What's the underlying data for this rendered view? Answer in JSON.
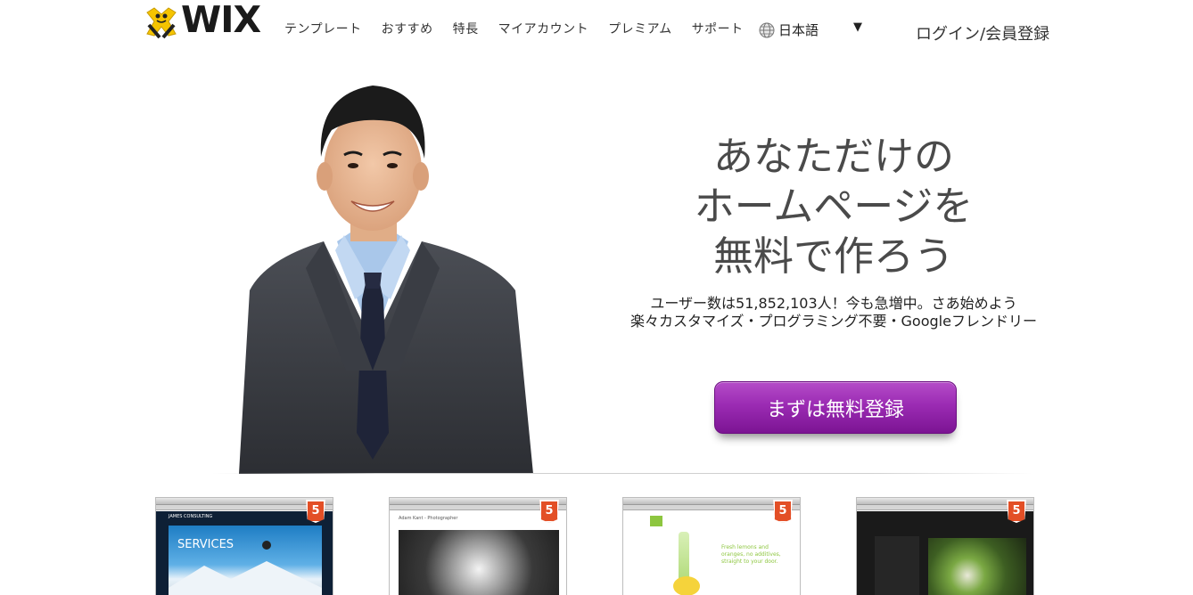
{
  "header": {
    "logo": "WIX",
    "nav": [
      "テンプレート",
      "おすすめ",
      "特長",
      "マイアカウント",
      "プレミアム",
      "サポート"
    ],
    "language": "日本語",
    "login": "ログイン/会員登録"
  },
  "hero": {
    "title_lines": [
      "あなただけの",
      "ホームページを",
      "無料で作ろう"
    ],
    "subtitle_lines": [
      "ユーザー数は51,852,103人！今も急増中。さあ始めよう",
      "楽々カスタマイズ・プログラミング不要・Googleフレンドリー"
    ],
    "cta": "まずは無料登録"
  },
  "templates": [
    {
      "badge": "5",
      "name": "JAMES CONSULTING",
      "heading": "SERVICES"
    },
    {
      "badge": "5",
      "name": "Adam Kant - Photographer"
    },
    {
      "badge": "5",
      "text": "Fresh lemons and oranges, no additives, straight to your door."
    },
    {
      "badge": "5"
    }
  ],
  "colors": {
    "cta": "#9b2bb3",
    "html5": "#e34f26",
    "logo_yellow": "#f5c400"
  }
}
